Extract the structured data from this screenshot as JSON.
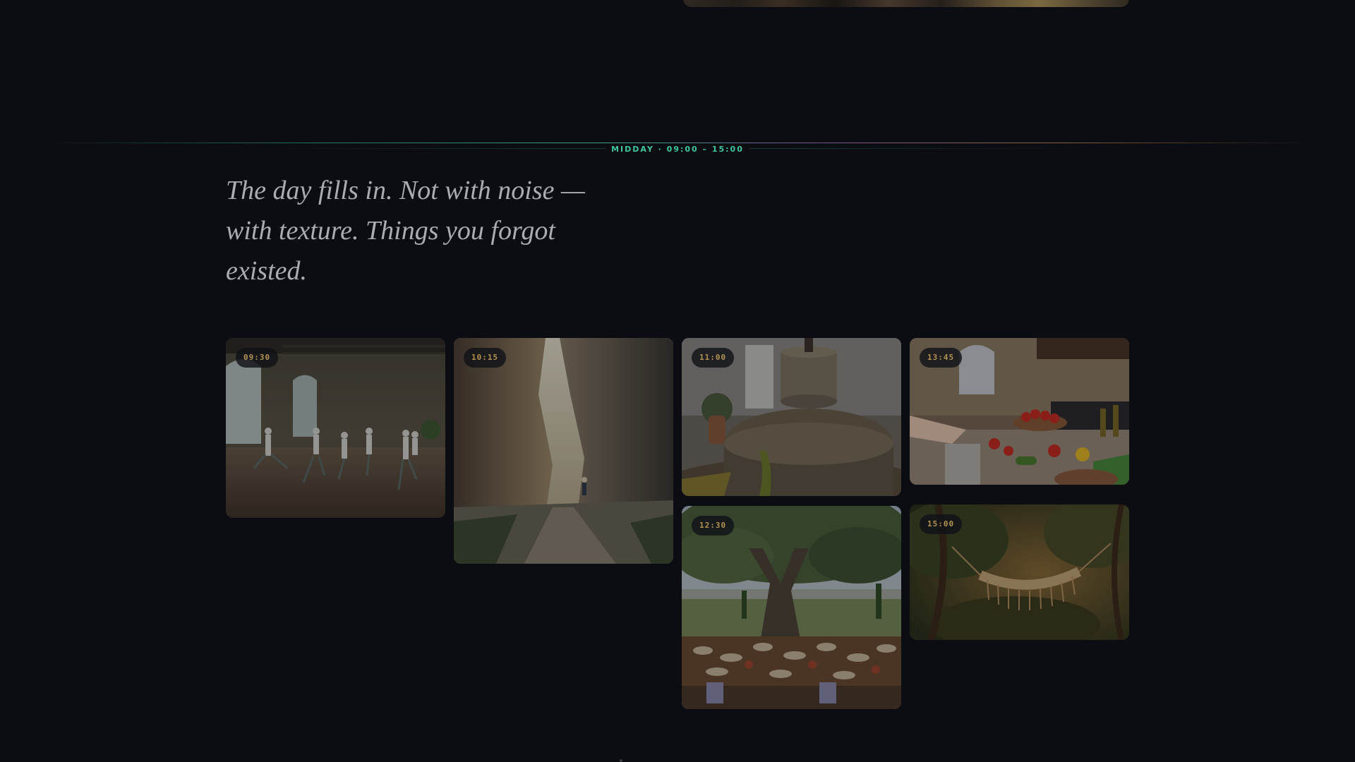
{
  "section": {
    "label": "MIDDAY · 09:00 – 15:00",
    "lead": "The day fills in. Not with noise — with texture. Things you forgot existed."
  },
  "colors": {
    "background": "#0b0d12",
    "accent_teal": "#3fc79e",
    "accent_gold": "#d9b060",
    "lead_text": "#a9acb2"
  },
  "gallery": {
    "items": [
      {
        "time": "09:30",
        "icon": "yoga-class-photo"
      },
      {
        "time": "10:15",
        "icon": "canyon-hike-photo"
      },
      {
        "time": "11:00",
        "icon": "olive-press-photo"
      },
      {
        "time": "13:45",
        "icon": "cooking-class-photo"
      },
      {
        "time": "12:30",
        "icon": "olive-grove-lunch-photo"
      },
      {
        "time": "15:00",
        "icon": "hammock-photo"
      }
    ]
  }
}
